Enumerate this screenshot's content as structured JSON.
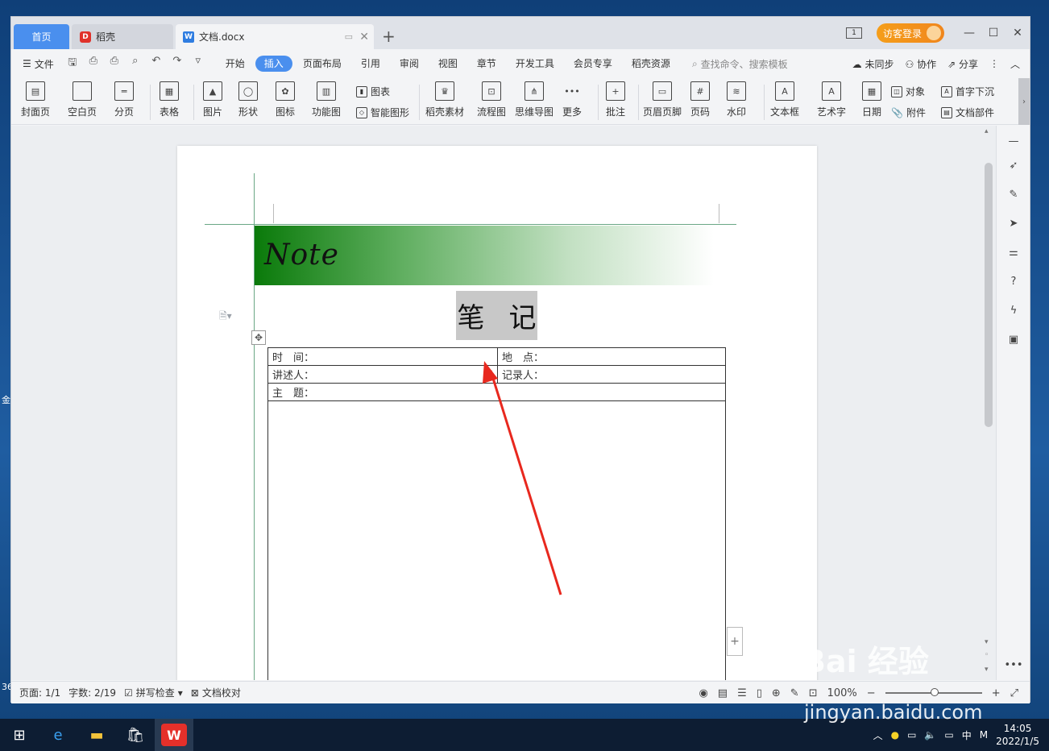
{
  "titlebar": {
    "home_tab": "首页",
    "daoke_tab": "稻壳",
    "doc_tab": "文档.docx",
    "new_tab": "+",
    "visitor_login": "访客登录"
  },
  "menubar": {
    "file": "文件",
    "tabs": [
      "开始",
      "插入",
      "页面布局",
      "引用",
      "审阅",
      "视图",
      "章节",
      "开发工具",
      "会员专享",
      "稻壳资源"
    ],
    "active_tab": "插入",
    "search": "查找命令、搜索模板",
    "unsync": "未同步",
    "collab": "协作",
    "share": "分享"
  },
  "ribbon": {
    "cover": "封面页",
    "blank": "空白页",
    "pagebreak": "分页",
    "table": "表格",
    "picture": "图片",
    "shape": "形状",
    "icons": "图标",
    "funcmap": "功能图",
    "chart": "图表",
    "smartart": "智能图形",
    "daoke_material": "稻壳素材",
    "flowchart": "流程图",
    "mindmap": "思维导图",
    "more": "更多",
    "comment": "批注",
    "header_footer": "页眉页脚",
    "pagenum": "页码",
    "watermark": "水印",
    "textbox": "文本框",
    "wordart": "艺术字",
    "date": "日期",
    "object": "对象",
    "attachment": "附件",
    "dropcap": "首字下沉",
    "docpart": "文档部件"
  },
  "document": {
    "banner": "Note",
    "title_char1": "笔",
    "title_char2": "记",
    "table": {
      "time": "时　间：",
      "place": "地　点：",
      "speaker": "讲述人：",
      "recorder": "记录人：",
      "topic": "主　题："
    }
  },
  "statusbar": {
    "page": "页面: 1/1",
    "words": "字数: 2/19",
    "spellcheck": "拼写检查",
    "proofread": "文档校对",
    "zoom": "100%"
  },
  "taskbar": {
    "time": "14:05",
    "date": "2022/1/5",
    "ime": "中",
    "ime2": "M"
  },
  "watermark": {
    "brand": "Bai 经验",
    "url": "jingyan.baidu.com"
  },
  "desktop": {
    "frag1": "金",
    "frag2": "36"
  },
  "colors": {
    "accent": "#4a8fee",
    "banner_green": "#0a7a0a",
    "arrow_red": "#e8281e"
  }
}
